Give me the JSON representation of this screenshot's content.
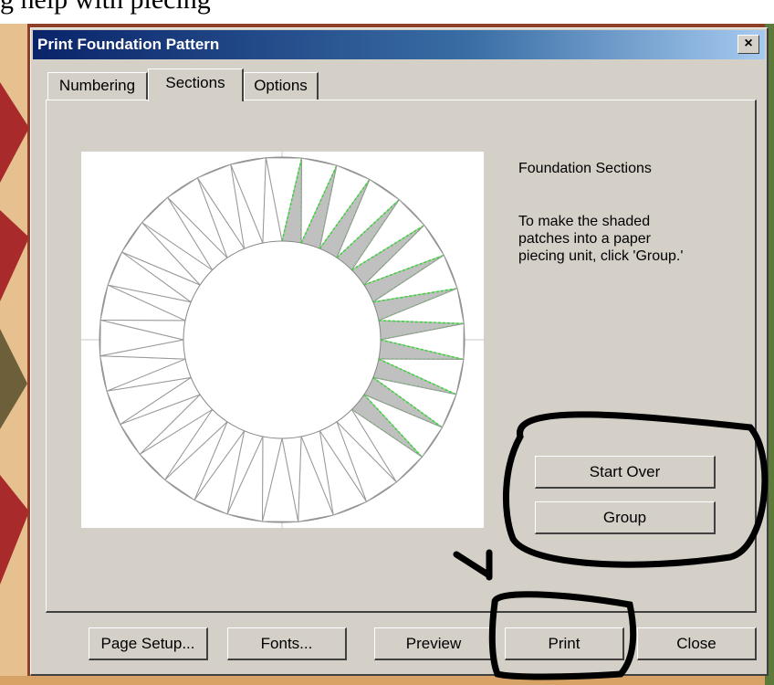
{
  "caption_text": "g help with piecing",
  "window": {
    "title": "Print Foundation Pattern",
    "close_glyph": "×"
  },
  "tabs": [
    {
      "label": "Numbering",
      "active": false
    },
    {
      "label": "Sections",
      "active": true
    },
    {
      "label": "Options",
      "active": false
    }
  ],
  "sections": {
    "heading": "Foundation Sections",
    "instruction": "To make the shaded patches into a paper piecing unit, click 'Group.'",
    "shade_color": "#c0c0c0",
    "selection_outline_color": "#39d639",
    "spikes_total": 32,
    "shaded_spikes": 12
  },
  "buttons": {
    "start_over": "Start Over",
    "group": "Group",
    "page_setup": "Page Setup...",
    "fonts": "Fonts...",
    "preview": "Preview",
    "print": "Print",
    "close": "Close"
  },
  "annotation_color": "#000000"
}
